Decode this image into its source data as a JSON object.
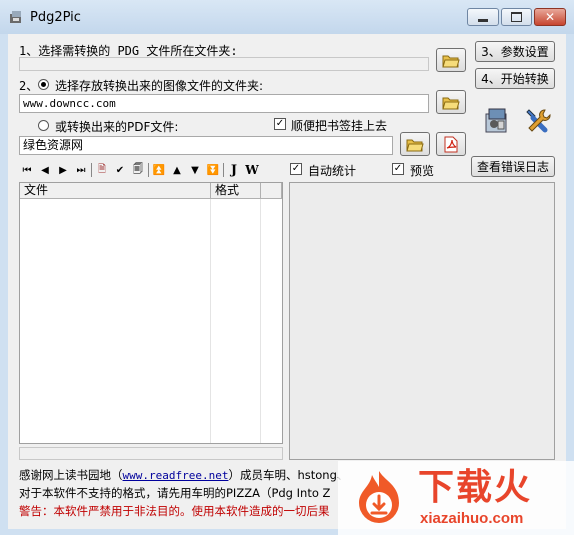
{
  "window": {
    "title": "Pdg2Pic"
  },
  "section1": {
    "label": "1、选择需转换的 PDG 文件所在文件夹:",
    "value": ""
  },
  "buttons": {
    "settings": "3、参数设置",
    "start": "4、开始转换",
    "view_log": "查看错误日志"
  },
  "section2": {
    "label": "2、",
    "radio_label": "选择存放转换出来的图像文件的文件夹:",
    "value": "www.downcc.com"
  },
  "section3": {
    "radio_label": "或转换出来的PDF文件:",
    "bookmark_label": "顺便把书签挂上去",
    "value": "绿色资源网"
  },
  "options": {
    "auto_stats": "自动统计",
    "preview": "预览"
  },
  "file_list": {
    "columns": [
      "文件",
      "格式"
    ],
    "rows": []
  },
  "footer": {
    "line1_prefix": "感谢网上读书园地（",
    "line1_link": "www.readfree.net",
    "line1_suffix": "）成员车明、hstong、",
    "line2": "对于本软件不支持的格式，请先用车明的PIZZA（Pdg Into Z",
    "line3": "警告：本软件严禁用于非法目的。使用本软件造成的一切后果"
  },
  "watermark": {
    "brand": "下载火",
    "url": "xiazaihuo.com"
  },
  "colors": {
    "title_bg": "#c9dcef",
    "client_bg": "#f0f0f0",
    "warning": "#c00000",
    "watermark": "#e8452b"
  }
}
